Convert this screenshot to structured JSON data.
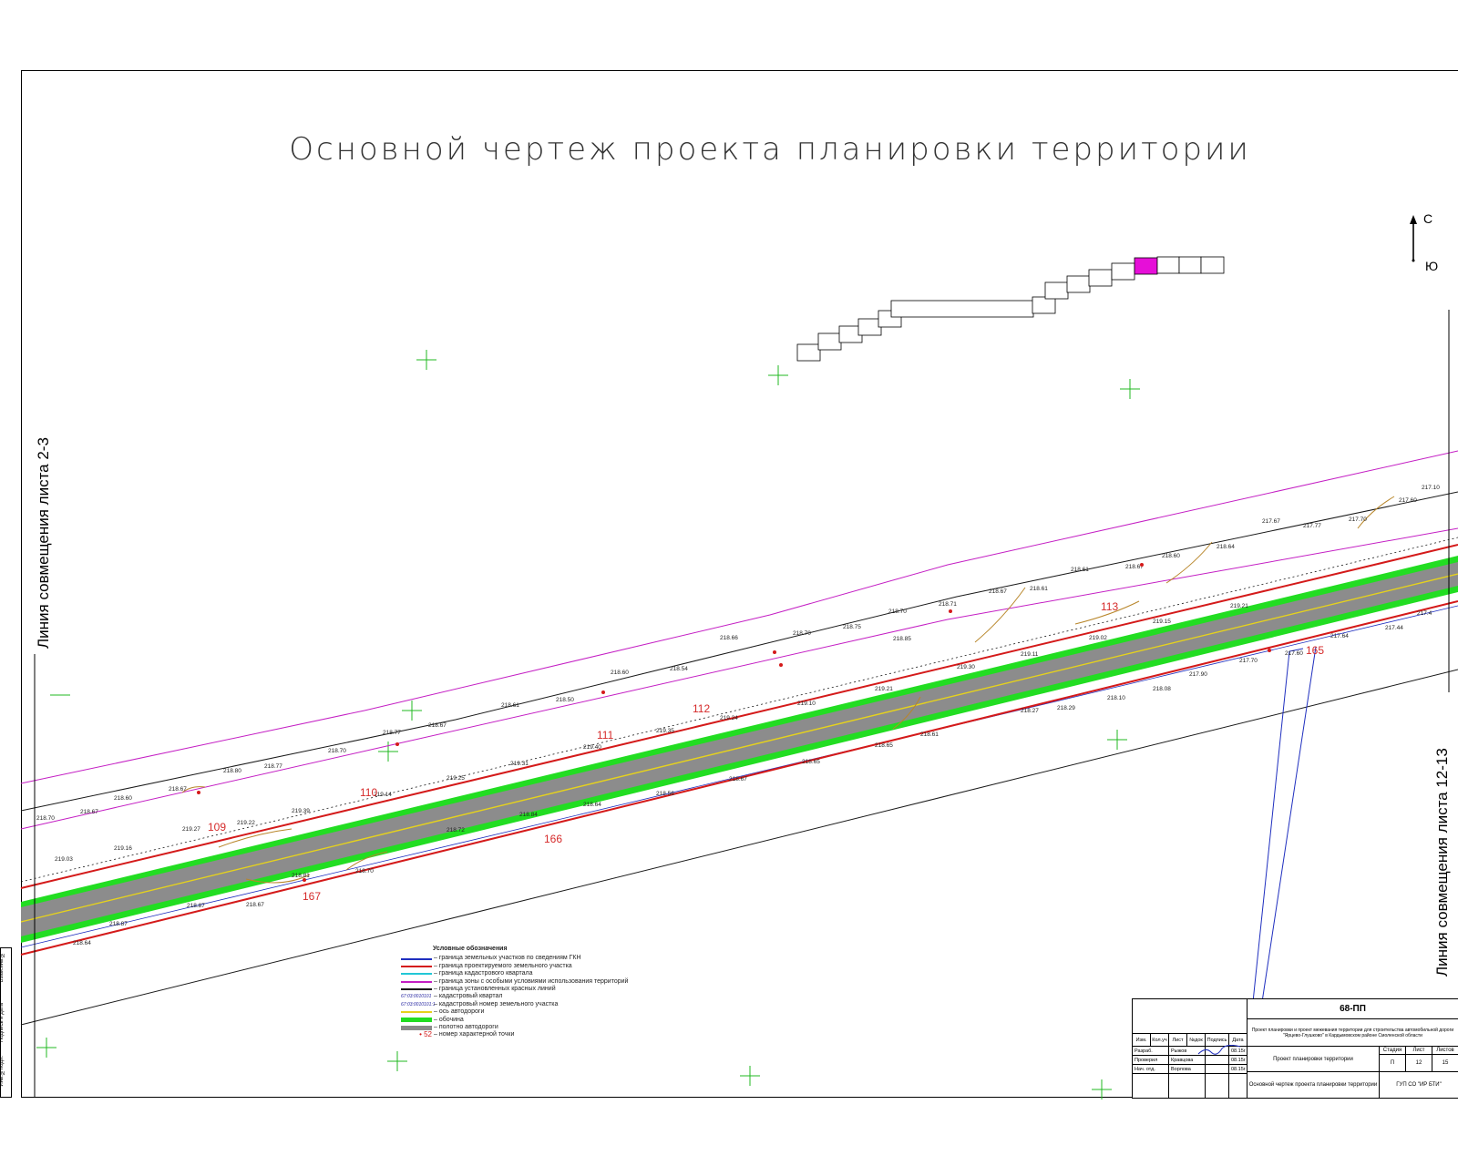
{
  "drawing": {
    "title": "Основной чертеж проекта планировки территории",
    "left_match_line": "Линия совмещения листа 2-3",
    "right_match_line": "Линия совмещения листа 12-13",
    "compass": {
      "north": "С",
      "south": "Ю"
    }
  },
  "road_labels": [
    {
      "text": "109",
      "color": "#d52a2a"
    },
    {
      "text": "110",
      "color": "#d52a2a"
    },
    {
      "text": "111",
      "color": "#d52a2a"
    },
    {
      "text": "112",
      "color": "#d52a2a"
    },
    {
      "text": "113",
      "color": "#d52a2a"
    },
    {
      "text": "165",
      "color": "#d52a2a"
    },
    {
      "text": "166",
      "color": "#d52a2a"
    },
    {
      "text": "167",
      "color": "#d52a2a"
    }
  ],
  "legend": {
    "title": "Условные обозначения",
    "items": [
      {
        "label": "– граница земельных участков по сведениям ГКН",
        "color": "#1f2fbf"
      },
      {
        "label": "– граница проектируемого земельного участка",
        "color": "#d41a1a"
      },
      {
        "label": "– граница кадастрового квартала",
        "color": "#22c7d6"
      },
      {
        "label": "– граница зоны с особыми условиями использования территорий",
        "color": "#c41fc4"
      },
      {
        "label": "– граница установленных красных линий",
        "color": "#1a1a1a"
      },
      {
        "label": "– кадастровый квартал",
        "color": "#1a1a9c"
      },
      {
        "label": "– кадастровый номер земельного участка",
        "color": "#1a1a9c"
      },
      {
        "label": "– ось автодороги",
        "color": "#e6d21c"
      },
      {
        "label": "– обочина",
        "color": "#22dd22"
      },
      {
        "label": "– полотно автодороги",
        "color": "#8a8a8a"
      },
      {
        "label": "– номер характерной точки",
        "color": "#d41a1a"
      }
    ],
    "sample_point": "52",
    "quarter_code": "67:03:0010101",
    "parcel_code": "67:03:0010101:1"
  },
  "stamp": {
    "code": "68-ПП",
    "project": "Проект планировки и проект межевания территории для строительства автомобильной дороги \"Ярцево-Глушково\" в Кардымовском районе Смоленской области",
    "headers": [
      "Изм.",
      "Кол.уч",
      "Лист",
      "№док",
      "Подпись",
      "Дата"
    ],
    "rows": [
      {
        "role": "Разраб.",
        "name": "Рыжов",
        "date": "08.15г"
      },
      {
        "role": "Проверил",
        "name": "Кравцова",
        "date": "08.15г"
      },
      {
        "role": "Нач. отд.",
        "name": "Ворлова",
        "date": "08.15г"
      }
    ],
    "doc_name": "Проект планировки территории",
    "sheet_name": "Основной чертеж проекта планировки территории",
    "stage_label": "Стадия",
    "sheet_label": "Лист",
    "sheets_label": "Листов",
    "stage": "П",
    "sheet": "12",
    "sheets": "15",
    "org": "ГУП СО \"ИР БТИ\""
  },
  "side_strip": [
    "Инв.№подл.",
    "Подпись и дата",
    "Взам.инв.№"
  ],
  "colors": {
    "road": "#8c8c8c",
    "shoulder": "#22dd22",
    "axis": "#e6d21c",
    "red_line": "#d41a1a",
    "magenta": "#c41fc4",
    "blue": "#1f2fbf",
    "highlight": "#e60fd8"
  }
}
